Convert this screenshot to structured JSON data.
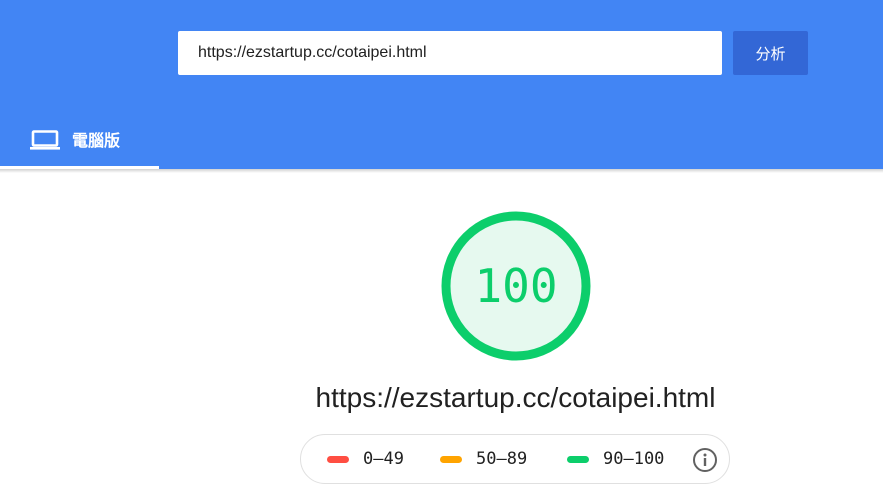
{
  "search": {
    "url_value": "https://ezstartup.cc/cotaipei.html",
    "analyze_label": "分析"
  },
  "tabs": [
    {
      "label": "電腦版",
      "icon": "laptop-icon",
      "selected": true
    }
  ],
  "report": {
    "score": "100",
    "score_fraction": 1.0,
    "url": "https://ezstartup.cc/cotaipei.html"
  },
  "legend": [
    {
      "label": "0–49",
      "color": "#ff4e42"
    },
    {
      "label": "50–89",
      "color": "#ffa400"
    },
    {
      "label": "90–100",
      "color": "#0cce6b"
    }
  ],
  "colors": {
    "header_bg": "#4285f4",
    "analyze_button_bg": "#3367d6",
    "pass_green": "#0cce6b",
    "gauge_fill": "#e6f9ef"
  }
}
